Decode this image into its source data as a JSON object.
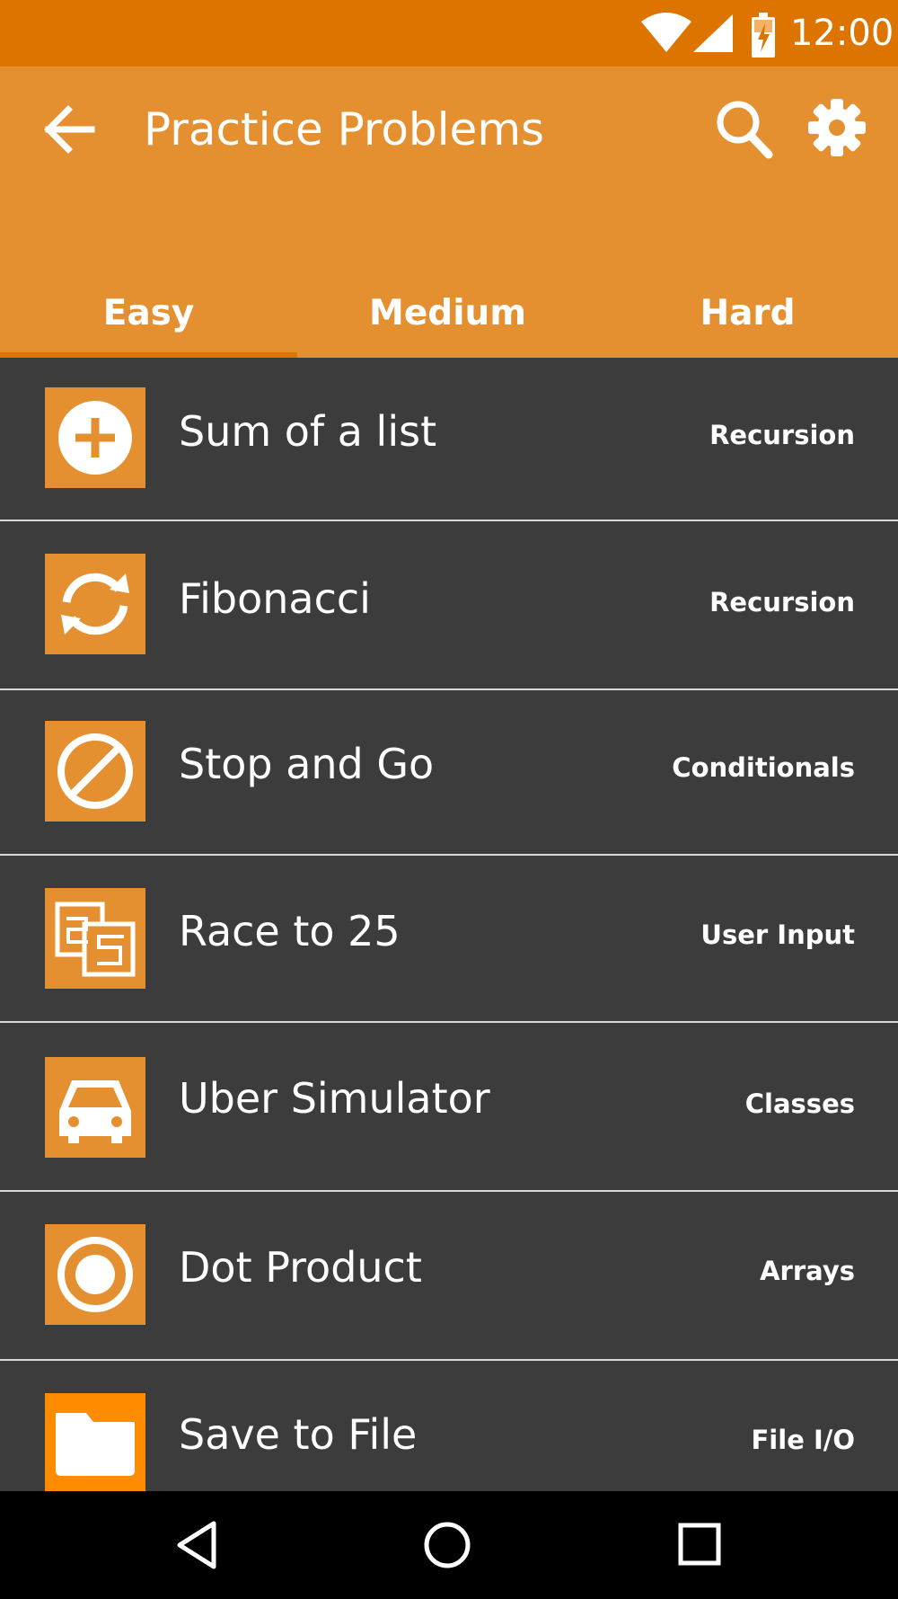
{
  "status_bar": {
    "time": "12:00",
    "icons": [
      "wifi-icon",
      "cell-signal-icon",
      "battery-charging-icon"
    ]
  },
  "toolbar": {
    "title": "Practice Problems",
    "back_icon": "arrow-back-icon",
    "search_icon": "search-icon",
    "settings_icon": "gear-icon",
    "background_color": "#e59030"
  },
  "tabs": [
    {
      "label": "Easy",
      "selected": true
    },
    {
      "label": "Medium",
      "selected": false
    },
    {
      "label": "Hard",
      "selected": false
    }
  ],
  "problems": [
    {
      "name": "Sum of a list",
      "category": "Recursion",
      "icon": "plus-circle-icon"
    },
    {
      "name": "Fibonacci",
      "category": "Recursion",
      "icon": "sync-icon"
    },
    {
      "name": "Stop and Go",
      "category": "Conditionals",
      "icon": "block-icon"
    },
    {
      "name": "Race to 25",
      "category": "User Input",
      "icon": "number-25-icon"
    },
    {
      "name": "Uber Simulator",
      "category": "Classes",
      "icon": "car-icon"
    },
    {
      "name": "Dot Product",
      "category": "Arrays",
      "icon": "radio-button-icon"
    },
    {
      "name": "Save to File",
      "category": "File I/O",
      "icon": "folder-icon"
    }
  ],
  "nav_bar": {
    "icons": [
      "nav-back-icon",
      "nav-home-icon",
      "nav-recents-icon"
    ]
  },
  "colors": {
    "status_bar": "#dd7400",
    "accent": "#e59030",
    "list_background": "#3c3c3c",
    "divider": "#d8d8d8"
  }
}
